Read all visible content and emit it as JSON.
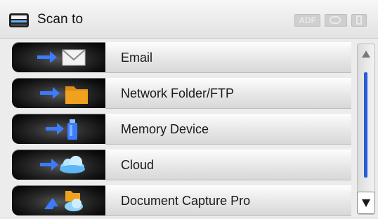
{
  "header": {
    "title": "Scan to",
    "status": [
      "ADF",
      "",
      ""
    ]
  },
  "items": [
    {
      "label": "Email",
      "icon": "email-icon"
    },
    {
      "label": "Network Folder/FTP",
      "icon": "folder-icon"
    },
    {
      "label": "Memory Device",
      "icon": "memory-device-icon"
    },
    {
      "label": "Cloud",
      "icon": "cloud-icon"
    },
    {
      "label": "Document Capture Pro",
      "icon": "document-capture-icon"
    }
  ],
  "colors": {
    "accent_blue": "#2a5cd8",
    "folder": "#f0a21e",
    "cloud": "#8fd3ff"
  },
  "scrollbar": {
    "up_icon": "scroll-up-icon",
    "down_icon": "scroll-down-icon"
  }
}
